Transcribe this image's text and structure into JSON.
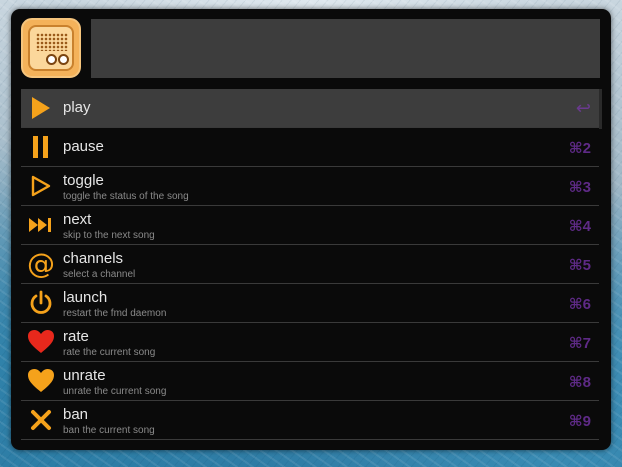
{
  "search": {
    "value": "",
    "placeholder": ""
  },
  "colors": {
    "accent": "#f5a21b",
    "heart": "#e8281c",
    "shortcut": "#5e2a86"
  },
  "items": [
    {
      "title": "play",
      "subtitle": "",
      "shortcut": "↩",
      "icon": "play-icon"
    },
    {
      "title": "pause",
      "subtitle": "",
      "shortcut": "⌘2",
      "icon": "pause-icon"
    },
    {
      "title": "toggle",
      "subtitle": "toggle the status of the song",
      "shortcut": "⌘3",
      "icon": "toggle-icon"
    },
    {
      "title": "next",
      "subtitle": "skip to the next song",
      "shortcut": "⌘4",
      "icon": "next-icon"
    },
    {
      "title": "channels",
      "subtitle": "select a channel",
      "shortcut": "⌘5",
      "icon": "at-icon"
    },
    {
      "title": "launch",
      "subtitle": "restart the fmd daemon",
      "shortcut": "⌘6",
      "icon": "power-icon"
    },
    {
      "title": "rate",
      "subtitle": "rate the current song",
      "shortcut": "⌘7",
      "icon": "heart-red-icon"
    },
    {
      "title": "unrate",
      "subtitle": "unrate the current song",
      "shortcut": "⌘8",
      "icon": "heart-orange-icon"
    },
    {
      "title": "ban",
      "subtitle": "ban the current song",
      "shortcut": "⌘9",
      "icon": "ban-icon"
    }
  ]
}
